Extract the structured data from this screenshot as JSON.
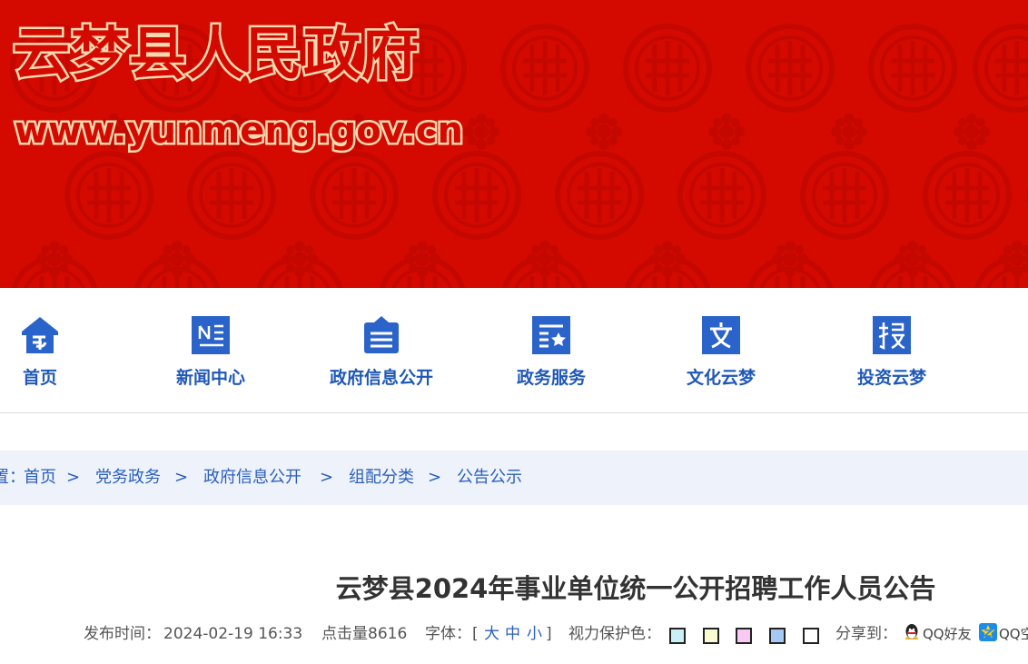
{
  "banner": {
    "site_title": "云梦县人民政府",
    "site_url": "www.yunmeng.gov.cn",
    "background_color": "#d40a00"
  },
  "nav": {
    "items": [
      {
        "label": "首页",
        "icon": "home-icon"
      },
      {
        "label": "新闻中心",
        "icon": "news-icon"
      },
      {
        "label": "政府信息公开",
        "icon": "gov-info-icon"
      },
      {
        "label": "政务服务",
        "icon": "gov-service-icon"
      },
      {
        "label": "文化云梦",
        "icon": "culture-icon"
      },
      {
        "label": "投资云梦",
        "icon": "invest-icon"
      }
    ],
    "accent_color": "#1f58b8"
  },
  "breadcrumb": {
    "prefix": "置：",
    "items": [
      "首页",
      "党务政务",
      "政府信息公开",
      "组配分类",
      "公告公示"
    ],
    "separator": ">"
  },
  "article": {
    "title": "云梦县2024年事业单位统一公开招聘工作人员公告",
    "publish_label": "发布时间：",
    "publish_time": "2024-02-19 16:33",
    "hits_label": "点击量",
    "hits": "8616",
    "font_label": "字体：",
    "font_open": "[",
    "font_sizes": [
      "大",
      "中",
      "小"
    ],
    "font_close": "]",
    "eye_label": "视力保护色：",
    "eye_colors": [
      "#c9f1f5",
      "#fbfbd1",
      "#f8c9f3",
      "#a6c9f2",
      "#ffffff"
    ],
    "share_label": "分享到：",
    "share_items": [
      {
        "label": "QQ好友",
        "icon": "qq-icon"
      },
      {
        "label": "QQ空",
        "icon": "qzone-icon"
      }
    ]
  }
}
